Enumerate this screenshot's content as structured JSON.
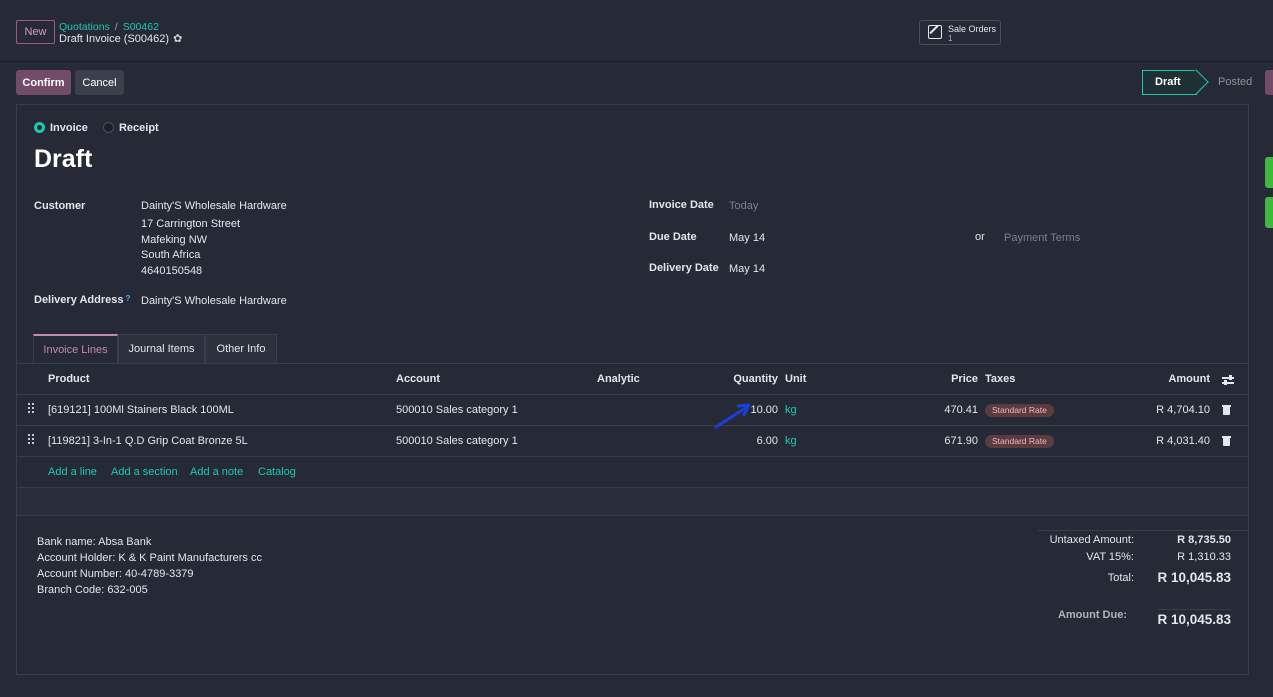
{
  "header": {
    "new_label": "New",
    "breadcrumb_parent": "Quotations",
    "breadcrumb_sep": "/",
    "breadcrumb_current": "S00462",
    "record_name": "Draft Invoice (S00462)",
    "smart_button_label": "Sale Orders",
    "smart_button_count": "1"
  },
  "actions": {
    "confirm_label": "Confirm",
    "cancel_label": "Cancel"
  },
  "status": {
    "stages": [
      "Draft",
      "Posted"
    ],
    "current": "Draft"
  },
  "form": {
    "type_options": [
      "Invoice",
      "Receipt"
    ],
    "type_selected": "Invoice",
    "title": "Draft",
    "customer_label": "Customer",
    "customer_lines": [
      "Dainty'S Wholesale Hardware",
      "17 Carrington Street",
      "Mafeking NW",
      "South Africa",
      "4640150548"
    ],
    "delivery_address_label": "Delivery Address",
    "delivery_address_tip": "?",
    "delivery_address_value": "Dainty'S Wholesale Hardware",
    "invoice_date_label": "Invoice Date",
    "invoice_date_placeholder": "Today",
    "due_date_label": "Due Date",
    "due_date_value": "May 14",
    "or_label": "or",
    "payment_terms_placeholder": "Payment Terms",
    "delivery_date_label": "Delivery Date",
    "delivery_date_value": "May 14"
  },
  "tabs": [
    "Invoice Lines",
    "Journal Items",
    "Other Info"
  ],
  "table": {
    "columns": [
      "Product",
      "Account",
      "Analytic",
      "Quantity",
      "Unit",
      "Price",
      "Taxes",
      "Amount"
    ],
    "rows": [
      {
        "product": "[619121] 100Ml Stainers Black 100ML",
        "account": "500010 Sales category 1",
        "analytic": "",
        "quantity": "10.00",
        "unit": "kg",
        "price": "470.41",
        "tax": "Standard Rate",
        "amount": "R 4,704.10"
      },
      {
        "product": "[119821] 3-In-1 Q.D Grip Coat Bronze 5L",
        "account": "500010 Sales category 1",
        "analytic": "",
        "quantity": "6.00",
        "unit": "kg",
        "price": "671.90",
        "tax": "Standard Rate",
        "amount": "R 4,031.40"
      }
    ],
    "add_links": [
      "Add a line",
      "Add a section",
      "Add a note",
      "Catalog"
    ]
  },
  "notes": [
    "Bank name: Absa Bank",
    "Account Holder: K & K Paint Manufacturers cc",
    "Account Number: 40-4789-3379",
    "Branch Code: 632-005"
  ],
  "totals": {
    "untaxed_label": "Untaxed Amount:",
    "untaxed_value": "R 8,735.50",
    "vat_label": "VAT 15%:",
    "vat_value": "R 1,310.33",
    "total_label": "Total:",
    "total_value": "R 10,045.83",
    "due_label": "Amount Due:",
    "due_value": "R 10,045.83"
  },
  "colors": {
    "accent": "#714b67",
    "link": "#1ec7b0",
    "background": "#262a36"
  }
}
